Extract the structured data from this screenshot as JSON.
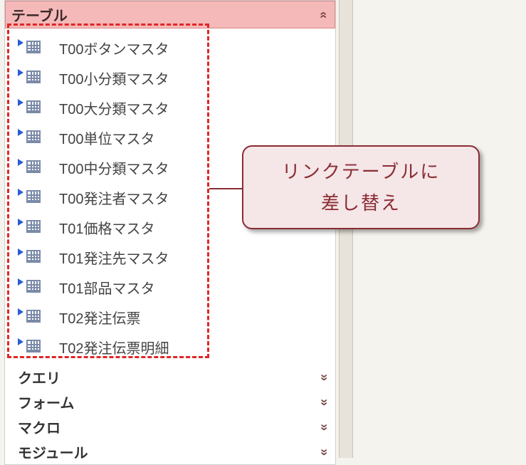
{
  "sections": {
    "tables": {
      "title": "テーブル",
      "items": [
        {
          "label": "T00ボタンマスタ"
        },
        {
          "label": "T00小分類マスタ"
        },
        {
          "label": "T00大分類マスタ"
        },
        {
          "label": "T00単位マスタ"
        },
        {
          "label": "T00中分類マスタ"
        },
        {
          "label": "T00発注者マスタ"
        },
        {
          "label": "T01価格マスタ"
        },
        {
          "label": "T01発注先マスタ"
        },
        {
          "label": "T01部品マスタ"
        },
        {
          "label": "T02発注伝票"
        },
        {
          "label": "T02発注伝票明細"
        }
      ]
    },
    "queries": {
      "title": "クエリ"
    },
    "forms": {
      "title": "フォーム"
    },
    "macros": {
      "title": "マクロ"
    },
    "modules": {
      "title": "モジュール"
    }
  },
  "callout": {
    "line1": "リンクテーブルに",
    "line2": "差し替え"
  },
  "glyphs": {
    "collapse": "«",
    "expand": "»"
  }
}
